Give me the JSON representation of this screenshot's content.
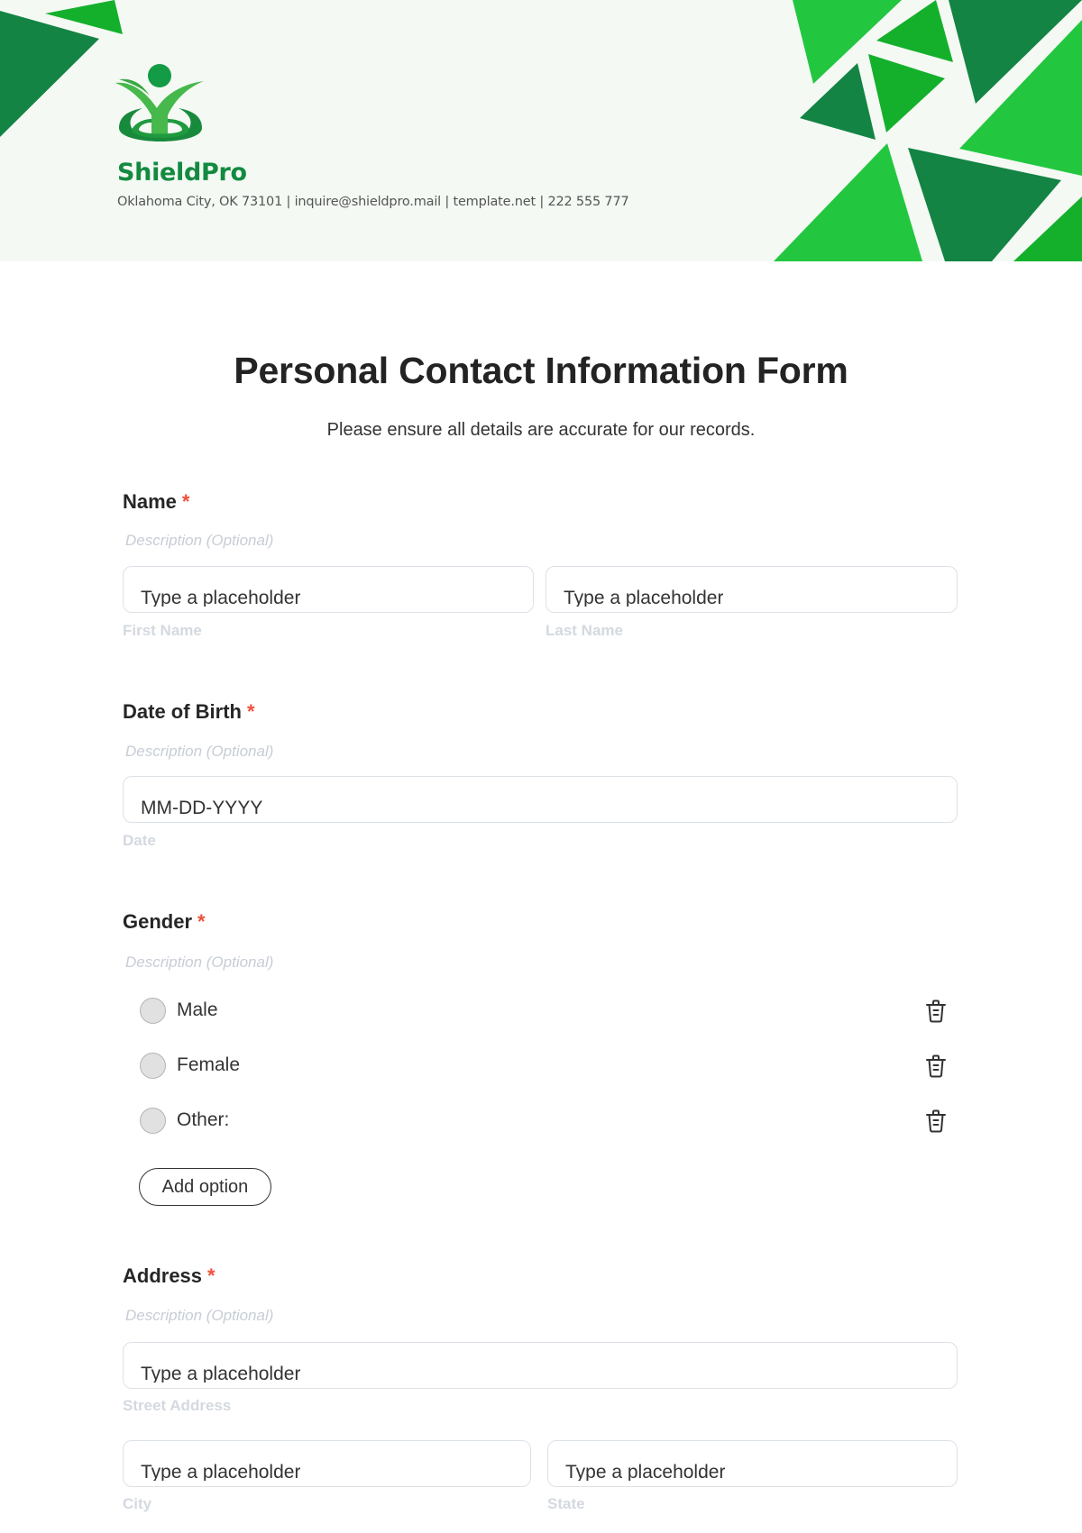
{
  "header": {
    "company_name": "ShieldPro",
    "contact_line": "Oklahoma City, OK 73101 | inquire@shieldpro.mail | template.net | 222 555 777",
    "colors": {
      "background": "#f4f9f4",
      "dark_green": "#138443",
      "mid_green": "#14b02c",
      "light_green": "#22c73f"
    }
  },
  "form": {
    "title": "Personal Contact Information Form",
    "subtitle": "Please ensure all details are accurate for our records.",
    "required_marker": "*",
    "questions": [
      {
        "label": "Name",
        "description_placeholder": "Description (Optional)",
        "fields": [
          {
            "placeholder": "Type a placeholder",
            "sublabel": "First Name"
          },
          {
            "placeholder": "Type a placeholder",
            "sublabel": "Last Name"
          }
        ]
      },
      {
        "label": "Date of Birth",
        "description_placeholder": "Description (Optional)",
        "fields": [
          {
            "placeholder": "MM-DD-YYYY",
            "sublabel": "Date"
          }
        ]
      },
      {
        "label": "Gender",
        "description_placeholder": "Description (Optional)",
        "options": [
          {
            "label": "Male",
            "icon": "trash-icon"
          },
          {
            "label": "Female",
            "icon": "trash-icon"
          },
          {
            "label": "Other:",
            "icon": "trash-icon"
          }
        ],
        "add_option_label": "Add option"
      },
      {
        "label": "Address",
        "description_placeholder": "Description (Optional)",
        "fields": [
          {
            "placeholder": "Type a placeholder",
            "sublabel": "Street Address"
          },
          {
            "placeholder": "Type a placeholder",
            "sublabel": "City"
          },
          {
            "placeholder": "Type a placeholder",
            "sublabel": "State"
          }
        ]
      }
    ]
  }
}
